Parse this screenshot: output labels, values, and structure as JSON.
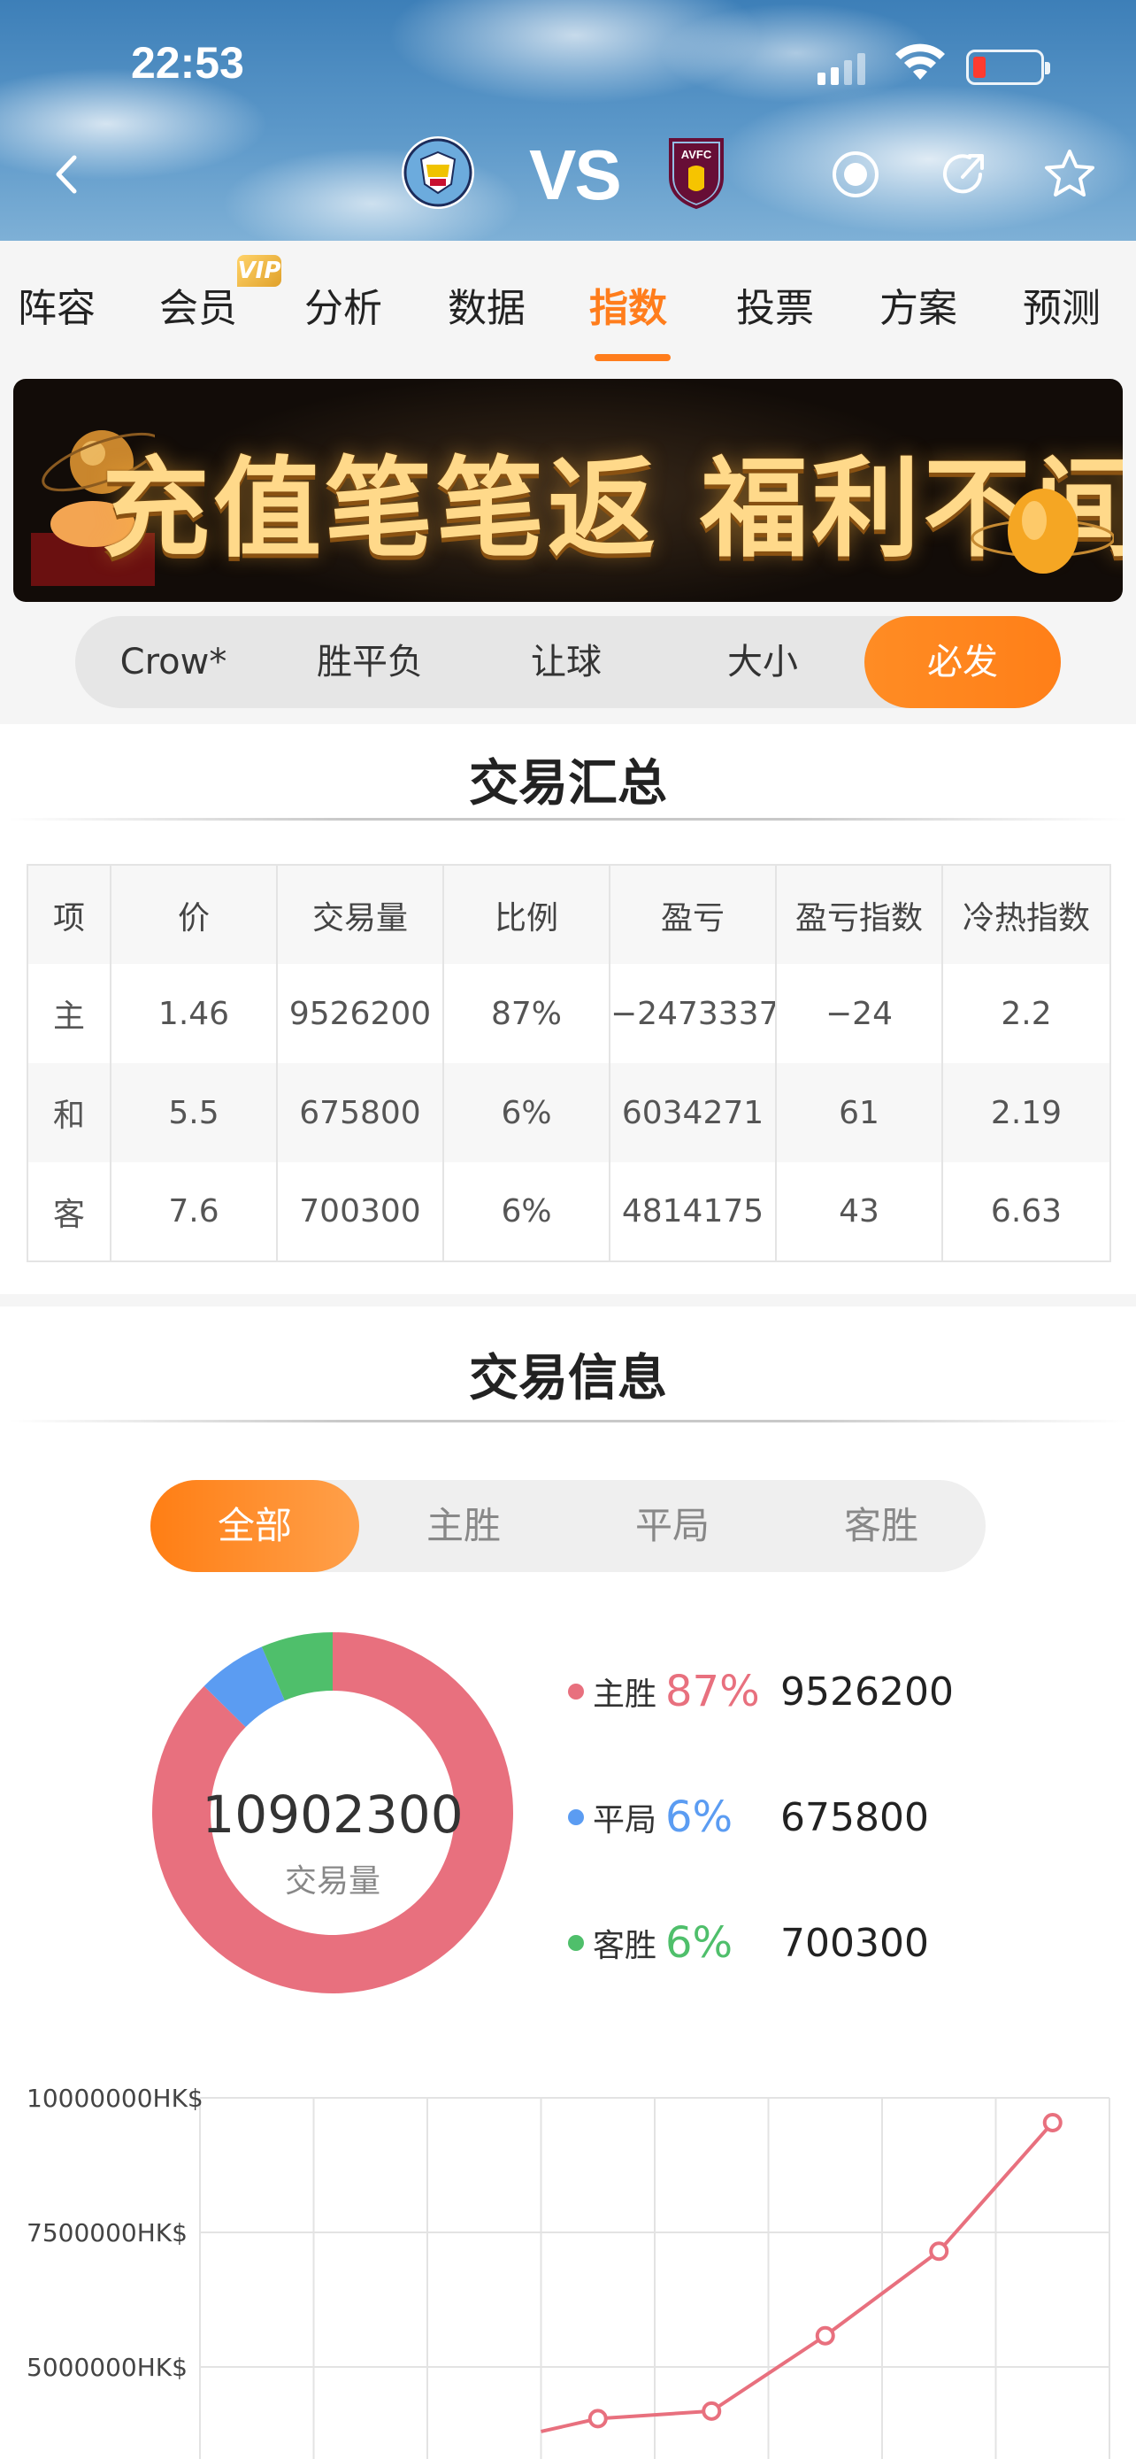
{
  "status_bar": {
    "time": "22:53"
  },
  "header": {
    "home_team": "Manchester City",
    "away_team": "Aston Villa",
    "home_logo_text": "MANCHESTER CITY",
    "away_logo_text": "AVFC",
    "vs_label": "VS",
    "icons": [
      "back-icon",
      "live-record-icon",
      "share-icon",
      "star-icon"
    ]
  },
  "tabs": [
    {
      "label": "阵容",
      "active": false
    },
    {
      "label": "会员",
      "active": false,
      "badge": "VIP"
    },
    {
      "label": "分析",
      "active": false
    },
    {
      "label": "数据",
      "active": false
    },
    {
      "label": "指数",
      "active": true
    },
    {
      "label": "投票",
      "active": false
    },
    {
      "label": "方案",
      "active": false
    },
    {
      "label": "预测",
      "active": false
    }
  ],
  "banner": {
    "text": "充值笔笔返 福利不间断"
  },
  "filter": {
    "items": [
      "Crow*",
      "胜平负",
      "让球",
      "大小",
      "必发"
    ],
    "active_index": 4
  },
  "summary": {
    "title": "交易汇总",
    "headers": [
      "项",
      "价",
      "交易量",
      "比例",
      "盈亏",
      "盈亏指数",
      "冷热指数"
    ],
    "rows": [
      [
        "主",
        "1.46",
        "9526200",
        "87%",
        "−2473337",
        "−24",
        "2.2"
      ],
      [
        "和",
        "5.5",
        "675800",
        "6%",
        "6034271",
        "61",
        "2.19"
      ],
      [
        "客",
        "7.6",
        "700300",
        "6%",
        "4814175",
        "43",
        "6.63"
      ]
    ]
  },
  "info": {
    "title": "交易信息",
    "tabs": [
      "全部",
      "主胜",
      "平局",
      "客胜"
    ],
    "active_tab": 0,
    "total": "10902300",
    "total_label": "交易量",
    "legend": [
      {
        "name": "主胜",
        "pct": "87%",
        "amount": "9526200",
        "color": "#e8707e"
      },
      {
        "name": "平局",
        "pct": "6%",
        "amount": "675800",
        "color": "#5b9cf2"
      },
      {
        "name": "客胜",
        "pct": "6%",
        "amount": "700300",
        "color": "#4fbf6b"
      }
    ]
  },
  "chart_data": {
    "type": "line",
    "title": "",
    "ylabel": "",
    "y_tick_labels": [
      "10000000HK$",
      "7500000HK$",
      "5000000HK$"
    ],
    "y_ticks": [
      10000000,
      7500000,
      5000000
    ],
    "ylim": [
      4000000,
      10000000
    ],
    "x_count": 9,
    "series": [
      {
        "color": "#e8707e",
        "points": [
          {
            "x": 3,
            "y": 3800000
          },
          {
            "x": 3.5,
            "y": 4040000
          },
          {
            "x": 4.5,
            "y": 4180000
          },
          {
            "x": 5.5,
            "y": 5580000
          },
          {
            "x": 6.5,
            "y": 7150000
          },
          {
            "x": 7.5,
            "y": 9540000
          }
        ]
      }
    ],
    "grid": true
  }
}
